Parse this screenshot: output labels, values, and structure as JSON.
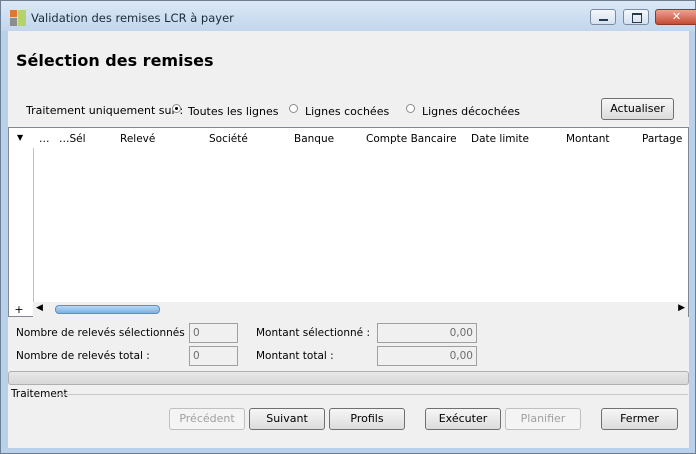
{
  "window": {
    "title": "Validation des remises LCR à payer"
  },
  "page": {
    "heading": "Sélection des remises"
  },
  "filter": {
    "label": "Traitement uniquement sur :",
    "options": [
      {
        "label": "Toutes les lignes",
        "selected": true
      },
      {
        "label": "Lignes cochées",
        "selected": false
      },
      {
        "label": "Lignes décochées",
        "selected": false
      }
    ],
    "refresh_label": "Actualiser"
  },
  "grid": {
    "columns": [
      "…",
      "…Sél",
      "Relevé",
      "Société",
      "Banque",
      "Compte Bancaire",
      "Date limite",
      "Montant",
      "Partage"
    ],
    "rows": []
  },
  "summary": {
    "selected_count_label": "Nombre de relevés sélectionnés :",
    "selected_count_value": "0",
    "total_count_label": "Nombre de relevés total :",
    "total_count_value": "0",
    "selected_amount_label": "Montant sélectionné :",
    "selected_amount_value": "0,00",
    "total_amount_label": "Montant total :",
    "total_amount_value": "0,00"
  },
  "status": {
    "section_label": "Traitement"
  },
  "buttons": {
    "previous": "Précédent",
    "next": "Suivant",
    "profiles": "Profils",
    "execute": "Exécuter",
    "schedule": "Planifier",
    "close": "Fermer"
  }
}
